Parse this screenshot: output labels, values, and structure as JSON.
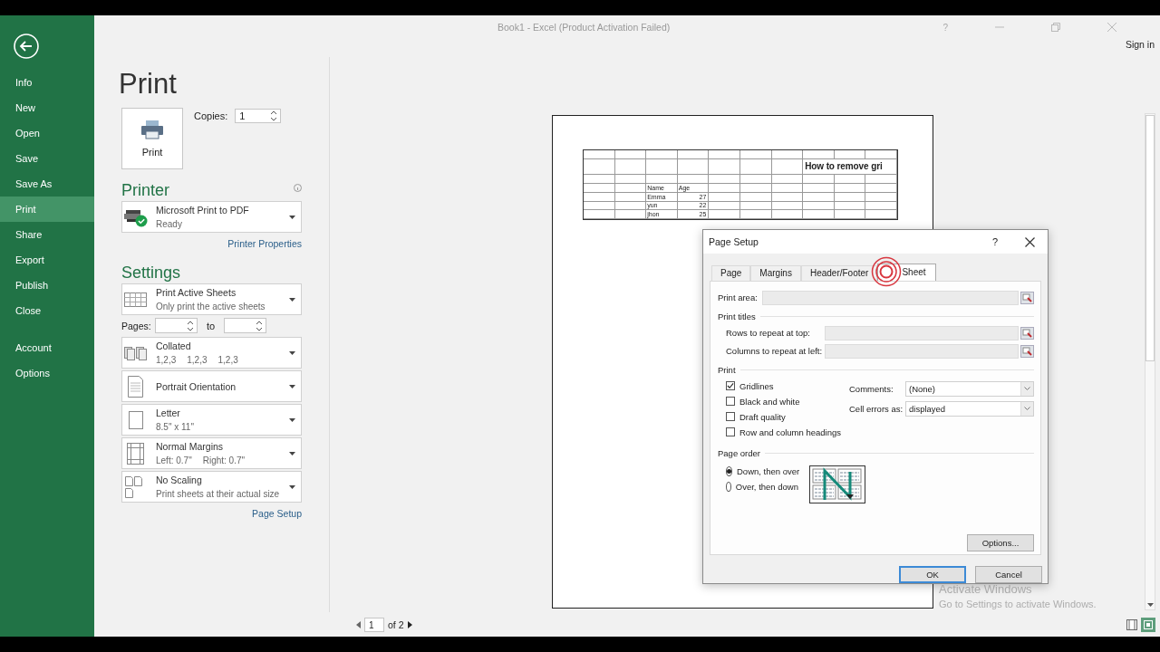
{
  "window": {
    "title": "Book1 - Excel (Product Activation Failed)",
    "help": "?",
    "sign_in": "Sign in"
  },
  "sidebar": {
    "items": [
      {
        "label": "Info",
        "selected": false
      },
      {
        "label": "New",
        "selected": false
      },
      {
        "label": "Open",
        "selected": false
      },
      {
        "label": "Save",
        "selected": false
      },
      {
        "label": "Save As",
        "selected": false
      },
      {
        "label": "Print",
        "selected": true
      },
      {
        "label": "Share",
        "selected": false
      },
      {
        "label": "Export",
        "selected": false
      },
      {
        "label": "Publish",
        "selected": false
      },
      {
        "label": "Close",
        "selected": false
      }
    ],
    "bottom_items": [
      {
        "label": "Account",
        "selected": false
      },
      {
        "label": "Options",
        "selected": false
      }
    ]
  },
  "page_title": "Print",
  "print_button": {
    "label": "Print"
  },
  "copies": {
    "label": "Copies:",
    "value": "1"
  },
  "printer": {
    "heading": "Printer",
    "name": "Microsoft Print to PDF",
    "status": "Ready",
    "link": "Printer Properties"
  },
  "settings": {
    "heading": "Settings",
    "options": [
      {
        "kind": "sheets",
        "title": "Print Active Sheets",
        "subtitle": "Only print the active sheets"
      },
      {
        "kind": "collated",
        "title": "Collated",
        "subtitle_parts": [
          "1,2,3",
          "1,2,3",
          "1,2,3"
        ]
      },
      {
        "kind": "orientation",
        "title": "Portrait Orientation"
      },
      {
        "kind": "paper",
        "title": "Letter",
        "subtitle": "8.5\" x 11\""
      },
      {
        "kind": "margins",
        "title": "Normal Margins",
        "subtitle_parts": [
          "Left:  0.7\"",
          "Right:  0.7\""
        ]
      },
      {
        "kind": "scaling",
        "title": "No Scaling",
        "subtitle": "Print sheets at their actual size"
      }
    ],
    "pages": {
      "label": "Pages:",
      "to": "to"
    },
    "link": "Page Setup"
  },
  "preview": {
    "sheet": {
      "title": "How to remove gri",
      "headers": [
        "Name",
        "Age"
      ],
      "rows": [
        [
          "Emma",
          "27"
        ],
        [
          "yun",
          "22"
        ],
        [
          "jhon",
          "25"
        ]
      ]
    },
    "page_nav": {
      "current": "1",
      "of": "of 2"
    }
  },
  "dialog": {
    "title": "Page Setup",
    "help": "?",
    "tabs": [
      {
        "label": "Page",
        "selected": false
      },
      {
        "label": "Margins",
        "selected": false
      },
      {
        "label": "Header/Footer",
        "selected": false
      },
      {
        "label": "Sheet",
        "selected": true
      }
    ],
    "print_area": {
      "label": "Print area:"
    },
    "print_titles": {
      "heading": "Print titles",
      "fields": [
        {
          "label": "Rows to repeat at top:"
        },
        {
          "label": "Columns to repeat at left:"
        }
      ]
    },
    "print": {
      "heading": "Print",
      "checks": [
        {
          "label": "Gridlines",
          "checked": true
        },
        {
          "label": "Black and white",
          "checked": false
        },
        {
          "label": "Draft quality",
          "checked": false
        },
        {
          "label": "Row and column headings",
          "checked": false
        }
      ],
      "dropdowns": [
        {
          "label": "Comments:",
          "value": "(None)"
        },
        {
          "label": "Cell errors as:",
          "value": "displayed"
        }
      ]
    },
    "page_order": {
      "heading": "Page order",
      "options": [
        {
          "label": "Down, then over",
          "selected": true
        },
        {
          "label": "Over, then down",
          "selected": false
        }
      ]
    },
    "options_button": "Options...",
    "buttons": [
      {
        "label": "OK",
        "default": true
      },
      {
        "label": "Cancel",
        "default": false
      }
    ]
  },
  "os_notice": {
    "title": "Activate Windows",
    "text": "Go to Settings to activate Windows."
  }
}
